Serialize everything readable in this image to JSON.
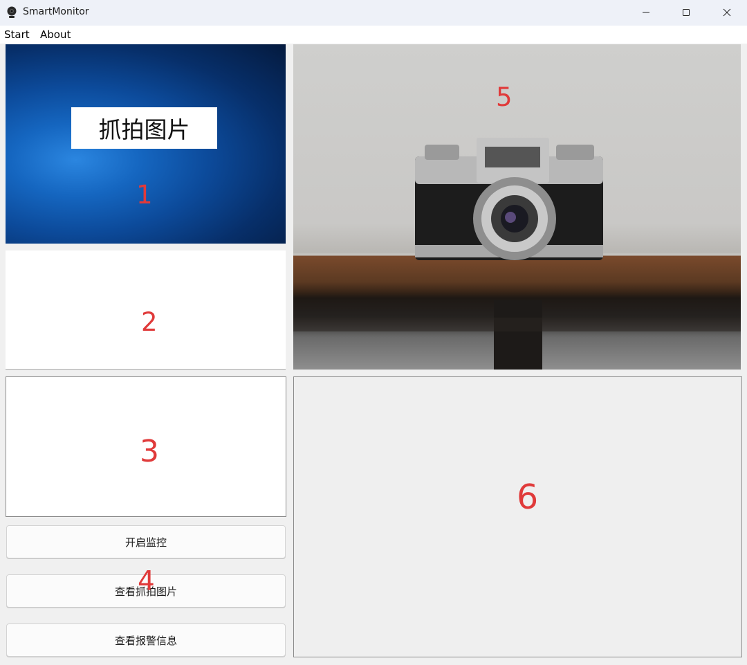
{
  "window": {
    "title": "SmartMonitor",
    "icon": "webcam-icon",
    "controls": [
      "minimize-icon",
      "maximize-icon",
      "close-icon"
    ]
  },
  "menu": {
    "items": [
      {
        "label": "Start"
      },
      {
        "label": "About"
      }
    ]
  },
  "panels": {
    "capture": {
      "label": "抓拍图片",
      "number": "1"
    },
    "panel2": {
      "number": "2"
    },
    "panel3": {
      "number": "3"
    },
    "buttons_area": {
      "number": "4"
    },
    "video": {
      "number": "5"
    },
    "panel6": {
      "number": "6"
    }
  },
  "buttons": [
    {
      "label": "开启监控"
    },
    {
      "label": "查看抓拍图片"
    },
    {
      "label": "查看报警信息"
    }
  ],
  "colors": {
    "annotation": "#e03a3a",
    "titlebar": "#eef1f8"
  }
}
